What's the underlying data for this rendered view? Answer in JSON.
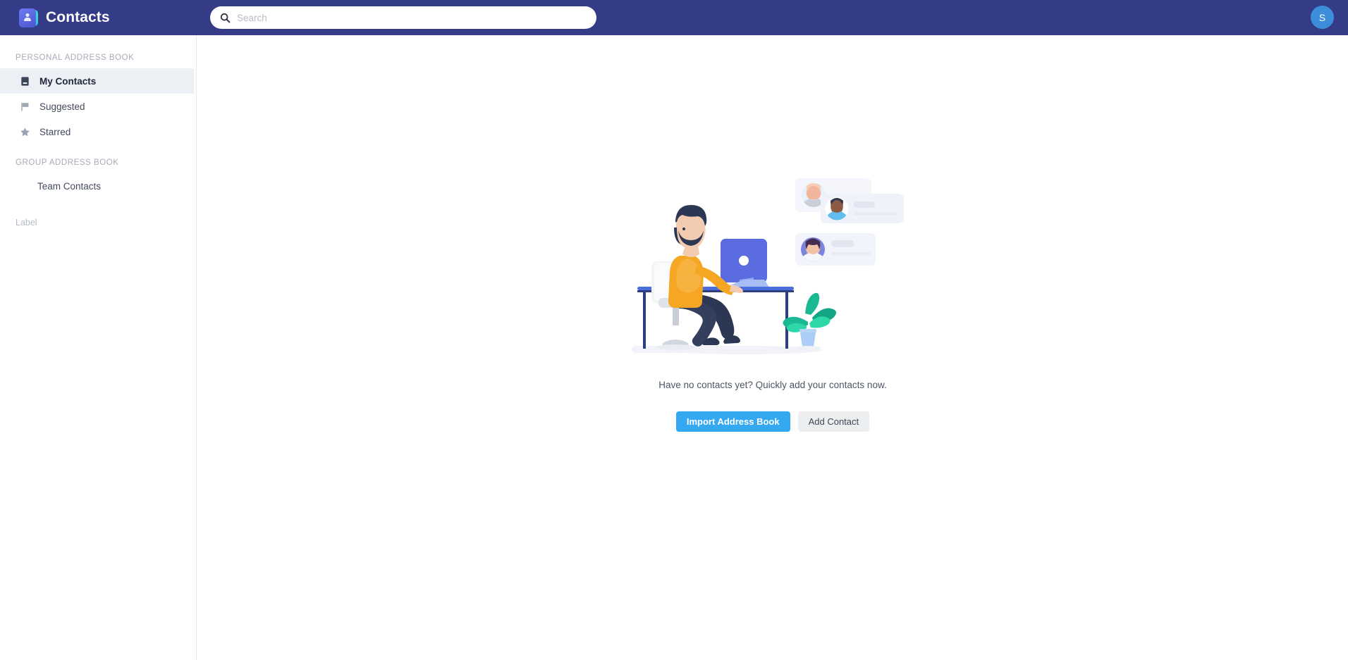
{
  "header": {
    "app_title": "Contacts",
    "logo_icon": "contacts-book-icon",
    "search": {
      "placeholder": "Search",
      "value": "",
      "icon": "search-icon"
    },
    "user_avatar": {
      "initial": "S",
      "color": "#3d8ddb"
    },
    "background_color": "#343c88"
  },
  "sidebar": {
    "personal_section": {
      "title": "PERSONAL ADDRESS BOOK",
      "items": [
        {
          "label": "My Contacts",
          "icon": "book-icon",
          "active": true
        },
        {
          "label": "Suggested",
          "icon": "flag-icon",
          "active": false
        },
        {
          "label": "Starred",
          "icon": "star-icon",
          "active": false
        }
      ]
    },
    "group_section": {
      "title": "GROUP ADDRESS BOOK",
      "items": [
        {
          "label": "Team Contacts",
          "icon": "none",
          "active": false
        }
      ]
    },
    "label_section": {
      "title": "Label"
    },
    "active_highlight_color": "#eceff4"
  },
  "main": {
    "empty_state": {
      "illustration_name": "person-at-desk-with-contact-cards-illustration",
      "message": "Have no contacts yet? Quickly add your contacts now.",
      "primary_button": {
        "label": "Import Address Book",
        "color": "#34a9f2"
      },
      "secondary_button": {
        "label": "Add Contact",
        "color": "#eceef0"
      }
    }
  }
}
